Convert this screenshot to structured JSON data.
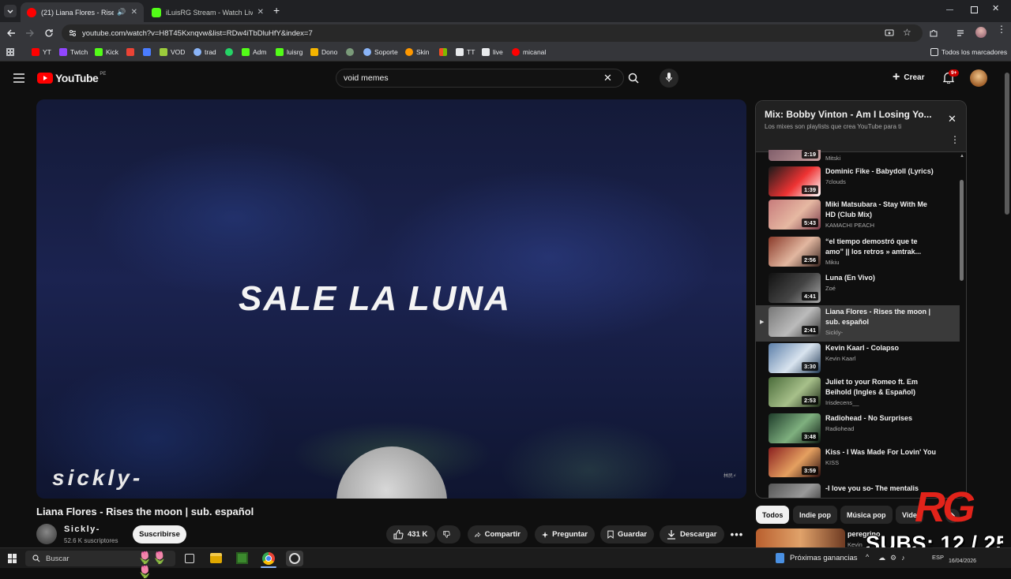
{
  "browser": {
    "tabs": [
      {
        "title": "(21) Liana Flores - Rises the moon",
        "favicon_color": "#ff0000",
        "active": true,
        "audio": true
      },
      {
        "title": "iLuisRG Stream - Watch Live on",
        "favicon_color": "#53fc18",
        "active": false
      }
    ],
    "url": "youtube.com/watch?v=H8T45Kxnqvw&list=RDw4iTbDluHfY&index=7",
    "bookmarks": [
      {
        "label": "YT",
        "color": "#ff0000"
      },
      {
        "label": "Twtch",
        "color": "#9146ff"
      },
      {
        "label": "Kick",
        "color": "#53fc18"
      },
      {
        "label": "VOD",
        "color": "#9ccc3c"
      },
      {
        "label": "trad",
        "color": "#8ab4f8"
      },
      {
        "label": "Adm",
        "color": "#53fc18"
      },
      {
        "label": "luisrg",
        "color": "#53fc18"
      },
      {
        "label": "Dono",
        "color": "#f4b400"
      },
      {
        "label": "Soporte",
        "color": "#8ab4f8"
      },
      {
        "label": "Skin",
        "color": "#ff9800"
      },
      {
        "label": "TT",
        "color": "#e8eaed"
      },
      {
        "label": "live",
        "color": "#e8eaed"
      },
      {
        "label": "micanal",
        "color": "#ff0000"
      }
    ],
    "all_bookmarks_label": "Todos los marcadores"
  },
  "youtube": {
    "logo_text": "YouTube",
    "region": "PE",
    "search_value": "void memes",
    "create_label": "Crear",
    "notifications_badge": "9+"
  },
  "video": {
    "caption": "SALE LA LUNA",
    "watermark": "sickly-",
    "corner_text": "林民⚡",
    "title": "Liana Flores - Rises the moon | sub. español",
    "channel": "Sickly-",
    "subscribers": "52.6 K suscriptores",
    "subscribe_label": "Suscribirse",
    "likes": "431 K",
    "share_label": "Compartir",
    "ask_label": "Preguntar",
    "save_label": "Guardar",
    "download_label": "Descargar"
  },
  "playlist": {
    "title": "Mix: Bobby Vinton - Am I Losing Yo...",
    "subtitle": "Los mixes son playlists que crea YouTube para ti",
    "partial_item": {
      "duration": "2:19",
      "channel": "Mitski"
    },
    "items": [
      {
        "title": "Dominic Fike - Babydoll (Lyrics)",
        "channel": "7clouds",
        "duration": "1:39",
        "thumb": [
          "#1a1a1a",
          "#e33",
          "#fff"
        ],
        "current": false
      },
      {
        "title": "Miki Matsubara - Stay With Me HD (Club Mix)",
        "channel": "KAMACHI PEACH",
        "duration": "5:43",
        "thumb": [
          "#c77b7b",
          "#e6b8a2",
          "#7a3b4a"
        ],
        "current": false
      },
      {
        "title": "“el tiempo demostró que te amo” || los retros » amtrak...",
        "channel": "Mikiu",
        "duration": "2:56",
        "thumb": [
          "#8a3a2a",
          "#e2b7a0",
          "#3a2520"
        ],
        "current": false
      },
      {
        "title": "Luna (En Vivo)",
        "channel": "Zoé",
        "duration": "4:41",
        "thumb": [
          "#111",
          "#444",
          "#aaa"
        ],
        "current": false
      },
      {
        "title": "Liana Flores - Rises the moon | sub. español",
        "channel": "Sickly-",
        "duration": "2:41",
        "thumb": [
          "#777",
          "#bbb",
          "#333"
        ],
        "current": true
      },
      {
        "title": "Kevin Kaarl - Colapso",
        "channel": "Kevin Kaarl",
        "duration": "3:30",
        "thumb": [
          "#5b7ea8",
          "#d9e4ef",
          "#233a55"
        ],
        "current": false
      },
      {
        "title": "Juliet to your Romeo ft. Em Beihold (Ingles & Español)",
        "channel": "Irisdecens__",
        "duration": "2:53",
        "thumb": [
          "#4a6b3a",
          "#a7c08a",
          "#1d2b18"
        ],
        "current": false
      },
      {
        "title": "Radiohead - No Surprises",
        "channel": "Radiohead",
        "duration": "3:48",
        "thumb": [
          "#1e3b2a",
          "#7fb07f",
          "#0d1a12"
        ],
        "current": false
      },
      {
        "title": "Kiss - I Was Made For Lovin' You",
        "channel": "KISS",
        "duration": "3:59",
        "thumb": [
          "#8a1f1f",
          "#e5a060",
          "#2a0d0d"
        ],
        "current": false
      },
      {
        "title": "-I love you so- The mentalis",
        "channel": "",
        "duration": "",
        "thumb": [
          "#555",
          "#999",
          "#222"
        ],
        "current": false
      }
    ]
  },
  "chips": [
    "Todos",
    "Indie pop",
    "Música pop",
    "Vide"
  ],
  "next_video": {
    "title": "peregrino",
    "channel": "Kevin"
  },
  "overlay": {
    "logo": "RG",
    "subs": "SUBS: 12 / 25"
  },
  "taskbar": {
    "search_placeholder": "Buscar",
    "news": "Próximas ganancias",
    "lang": "ESP",
    "date": "16/04/2026"
  }
}
